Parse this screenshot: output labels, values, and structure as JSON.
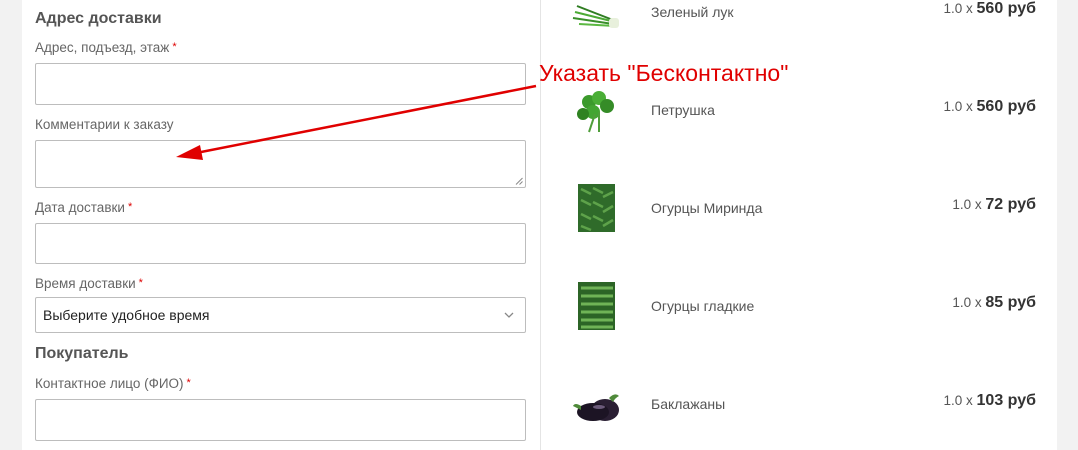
{
  "delivery": {
    "title": "Адрес доставки",
    "address_label": "Адрес, подъезд, этаж",
    "address_value": "",
    "comment_label": "Комментарии к заказу",
    "comment_value": "",
    "date_label": "Дата доставки",
    "date_value": "",
    "time_label": "Время доставки",
    "time_selected": "Выберите удобное время",
    "required_mark": "*"
  },
  "buyer": {
    "title": "Покупатель",
    "contact_label": "Контактное лицо (ФИО)",
    "contact_value": ""
  },
  "annotation": {
    "text": "Указать \"Бесконтактно\"",
    "color": "#e00000"
  },
  "cart": {
    "items": [
      {
        "name": "Зеленый лук",
        "qty": "1.0 x",
        "price": "560 руб",
        "icon": "green-onion-icon"
      },
      {
        "name": "Петрушка",
        "qty": "1.0 x",
        "price": "560 руб",
        "icon": "parsley-icon"
      },
      {
        "name": "Огурцы Миринда",
        "qty": "1.0 x",
        "price": "72 руб",
        "icon": "cucumber-box-icon"
      },
      {
        "name": "Огурцы гладкие",
        "qty": "1.0 x",
        "price": "85 руб",
        "icon": "cucumber-box-icon"
      },
      {
        "name": "Баклажаны",
        "qty": "1.0 x",
        "price": "103 руб",
        "icon": "eggplant-icon"
      }
    ]
  }
}
